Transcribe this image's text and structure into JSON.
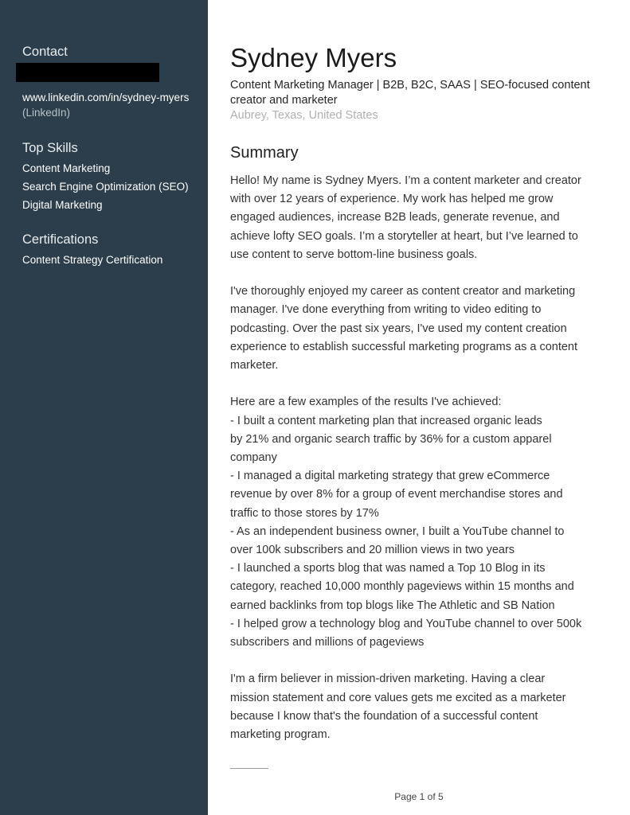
{
  "sidebar": {
    "contact": {
      "heading": "Contact",
      "redacted": true,
      "linkedin_url": "www.linkedin.com/in/sydney-myers",
      "linkedin_label": "(LinkedIn)"
    },
    "top_skills": {
      "heading": "Top Skills",
      "items": [
        "Content Marketing",
        "Search Engine Optimization (SEO)",
        "Digital Marketing"
      ]
    },
    "certifications": {
      "heading": "Certifications",
      "items": [
        "Content Strategy Certification"
      ]
    }
  },
  "main": {
    "name": "Sydney Myers",
    "headline": "Content Marketing Manager | B2B, B2C, SAAS | SEO-focused content creator and marketer",
    "location": "Aubrey, Texas, United States",
    "summary_title": "Summary",
    "summary_paragraphs": [
      [
        "Hello! My name is Sydney Myers. I’m a content marketer and creator",
        "with over 12 years of experience. My work has helped me grow",
        "engaged audiences, increase B2B leads, generate revenue, and",
        "achieve lofty SEO goals. I’m a storyteller at heart, but I’ve learned to",
        "use content to serve bottom-line business goals."
      ],
      [
        "I've thoroughly enjoyed my career as content creator and marketing",
        "manager. I've done everything from writing to video editing to",
        "podcasting. Over the past six years, I've used my content creation",
        "experience to establish successful marketing programs as a content",
        "marketer."
      ],
      [
        "Here are a few examples of the results I've achieved:",
        "- I built a content marketing plan that increased organic leads",
        "by 21% and organic search traffic by 36% for a custom apparel",
        "company",
        "- I managed a digital marketing strategy that grew eCommerce",
        "revenue by over 8% for a group of event merchandise stores and",
        "traffic to those stores by 17%",
        "- As an independent business owner, I built a YouTube channel to",
        "over 100k subscribers and 20 million views in two years",
        "- I launched a sports blog that was named a Top 10 Blog in its",
        "category, reached 10,000 monthly pageviews within 15 months and",
        "earned backlinks from top blogs like The Athletic and SB Nation",
        "- I helped grow a technology blog and YouTube channel to over 500k",
        "subscribers and millions of pageviews"
      ],
      [
        "I'm a firm believer in mission-driven marketing. Having a clear",
        "mission statement and core values gets me excited as a marketer",
        "because I know that's the foundation of a successful content",
        "marketing program."
      ]
    ]
  },
  "footer": {
    "page_label": "Page 1 of 5"
  },
  "colors": {
    "sidebar_bg": "#2c3e4b",
    "location_text": "#b0b0b0"
  }
}
